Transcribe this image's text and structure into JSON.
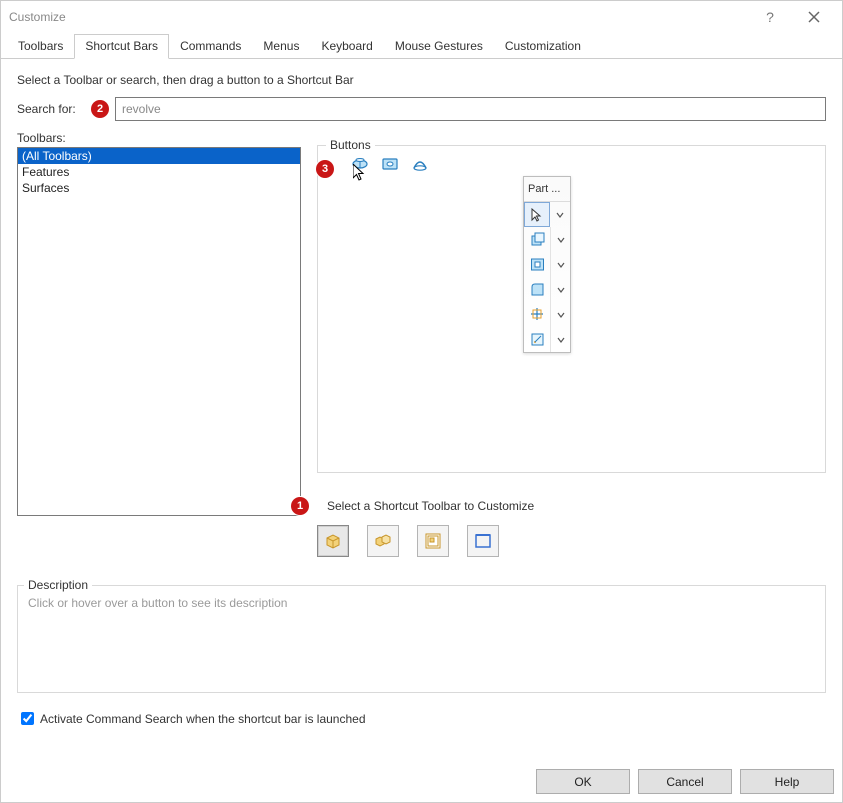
{
  "window": {
    "title": "Customize"
  },
  "tabs": {
    "items": [
      {
        "label": "Toolbars"
      },
      {
        "label": "Shortcut Bars"
      },
      {
        "label": "Commands"
      },
      {
        "label": "Menus"
      },
      {
        "label": "Keyboard"
      },
      {
        "label": "Mouse Gestures"
      },
      {
        "label": "Customization"
      }
    ],
    "active_index": 1
  },
  "instruction": "Select a Toolbar or search, then drag a button to a Shortcut Bar",
  "search": {
    "label": "Search for:",
    "value": "revolve"
  },
  "badges": {
    "b1": "1",
    "b2": "2",
    "b3": "3"
  },
  "toolbars": {
    "label": "Toolbars:",
    "items": [
      {
        "label": "(All Toolbars)",
        "selected": true
      },
      {
        "label": "Features",
        "selected": false
      },
      {
        "label": "Surfaces",
        "selected": false
      }
    ]
  },
  "buttons_group": {
    "legend": "Buttons",
    "icons": [
      {
        "name": "revolve-boss-icon"
      },
      {
        "name": "revolve-cut-icon"
      },
      {
        "name": "revolve-surface-icon"
      }
    ]
  },
  "floating_toolbar": {
    "title": "Part ...",
    "rows": [
      {
        "name": "select-tool",
        "selected": true
      },
      {
        "name": "extrude-boss"
      },
      {
        "name": "extrude-cut"
      },
      {
        "name": "fillet"
      },
      {
        "name": "reference-geometry"
      },
      {
        "name": "sketch-flyout"
      }
    ]
  },
  "select_toolbar": {
    "label": "Select a Shortcut Toolbar to Customize",
    "buttons": [
      {
        "name": "part-shortcut",
        "active": true,
        "color": "#e4b63d"
      },
      {
        "name": "assembly-shortcut",
        "active": false,
        "color": "#e4b63d"
      },
      {
        "name": "drawing-shortcut",
        "active": false,
        "color": "#d8a62b"
      },
      {
        "name": "sketch-shortcut",
        "active": false,
        "color": "#3a72d2"
      }
    ]
  },
  "description": {
    "legend": "Description",
    "text": "Click or hover over a button to see its description"
  },
  "checkbox": {
    "label": "Activate Command Search when the shortcut bar is launched",
    "checked": true
  },
  "footer": {
    "ok": "OK",
    "cancel": "Cancel",
    "help": "Help"
  }
}
